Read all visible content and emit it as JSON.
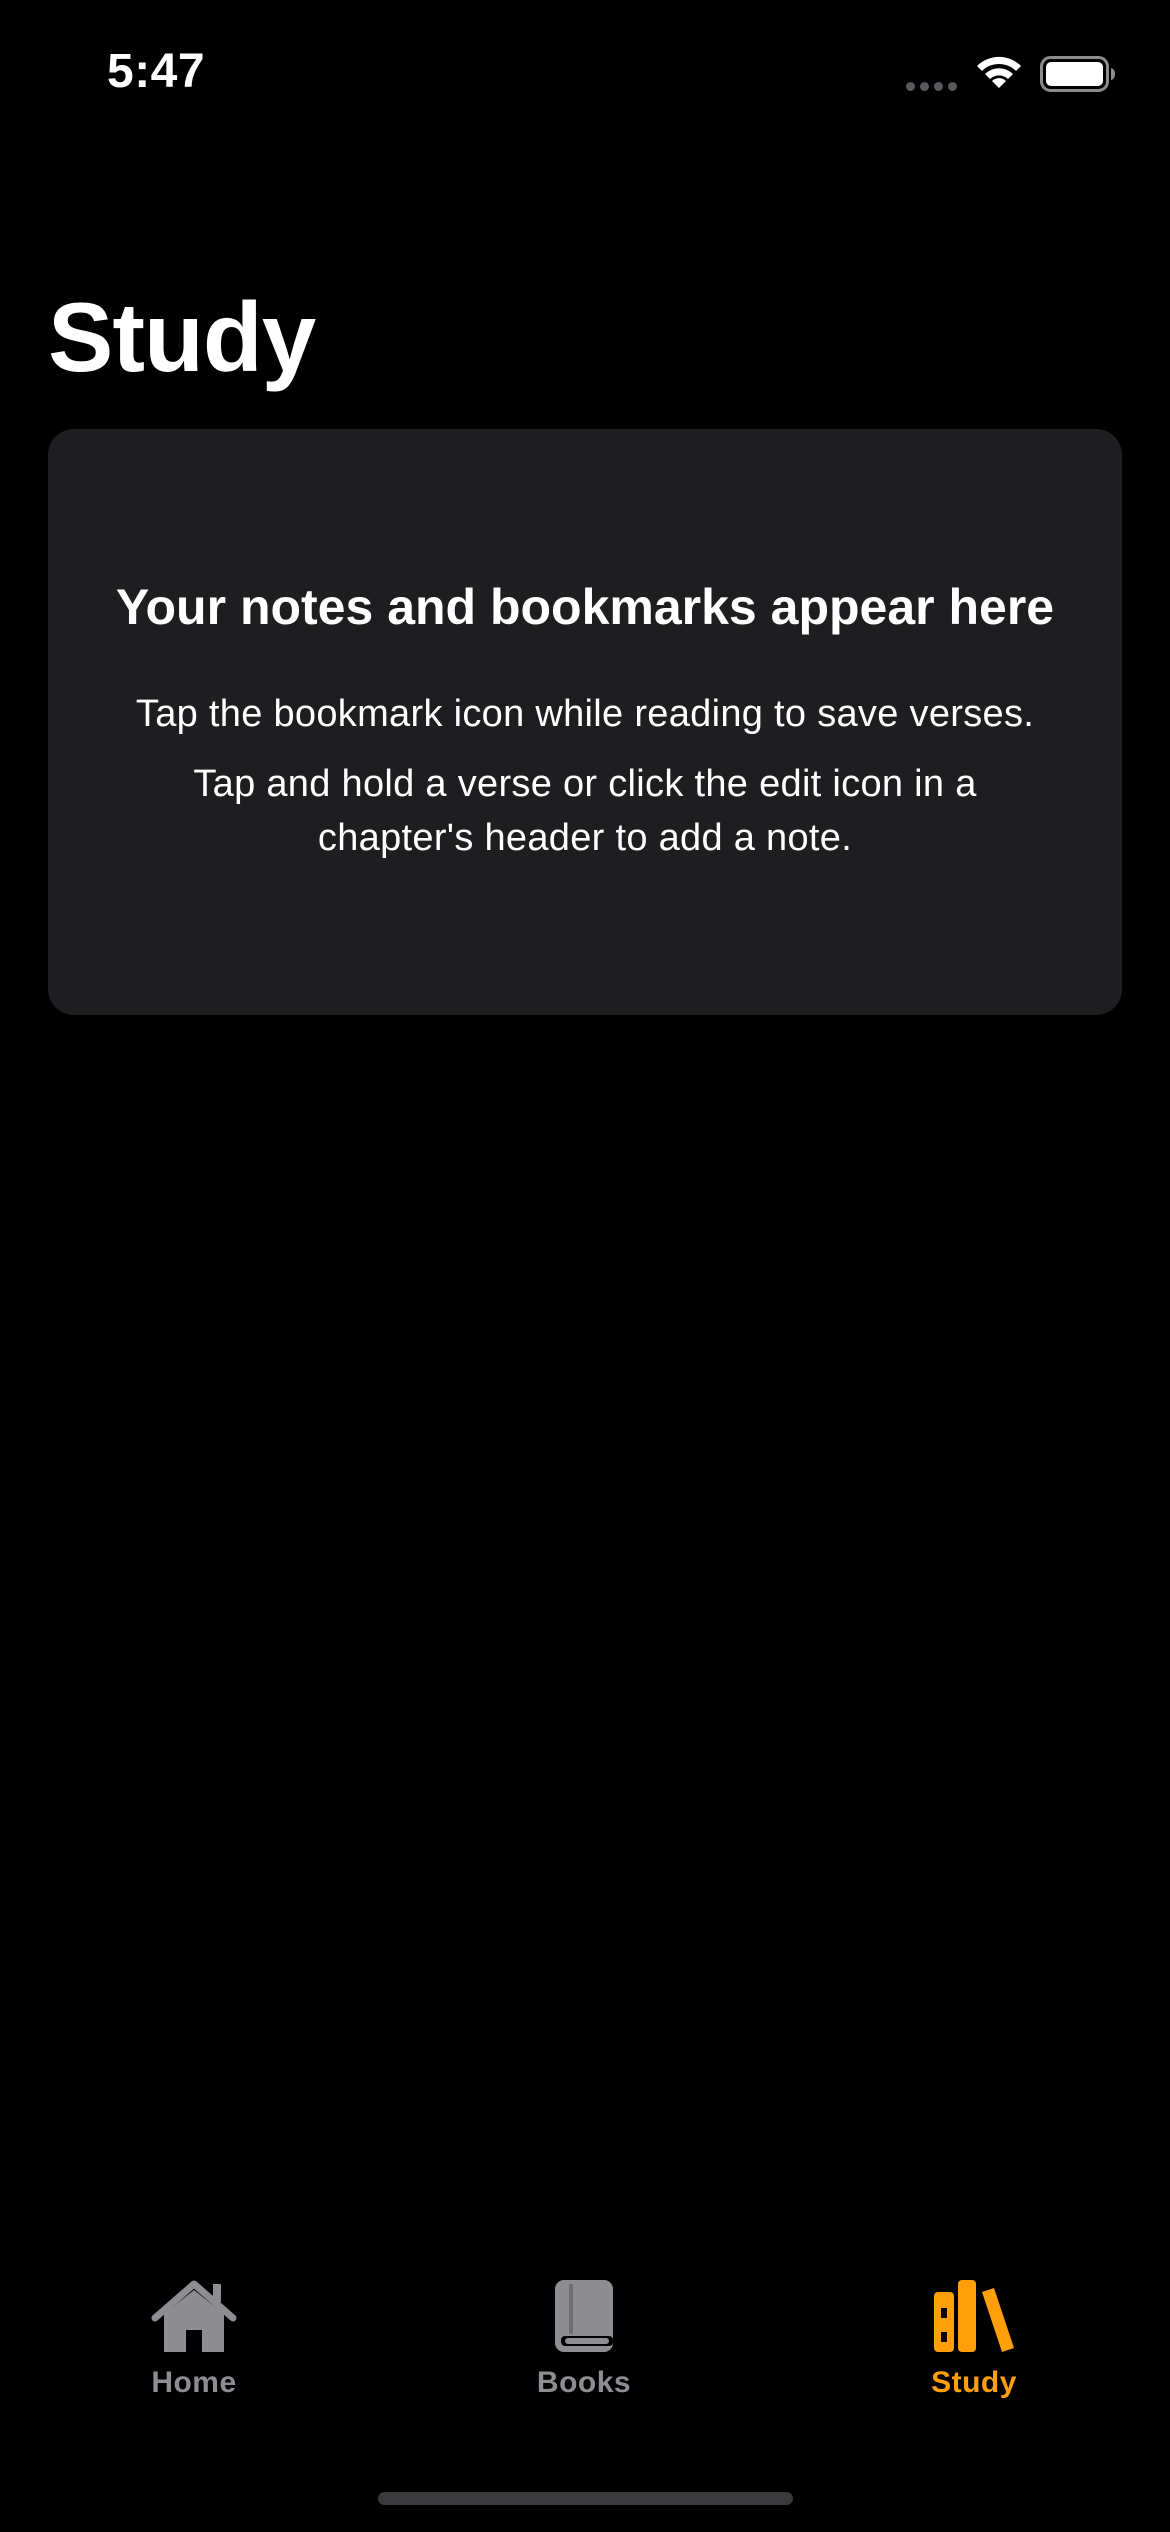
{
  "status_bar": {
    "time": "5:47",
    "wifi_icon": "wifi-icon",
    "battery_icon": "battery-icon"
  },
  "page": {
    "title": "Study"
  },
  "empty_state": {
    "heading": "Your notes and bookmarks appear here",
    "line1": "Tap the bookmark icon while reading to save verses.",
    "line2": "Tap and hold a verse or click the edit icon in a chapter's header to add a note."
  },
  "tab_bar": {
    "tabs": [
      {
        "label": "Home",
        "icon": "house-icon",
        "active": false
      },
      {
        "label": "Books",
        "icon": "book-icon",
        "active": false
      },
      {
        "label": "Study",
        "icon": "books-shelf-icon",
        "active": true
      }
    ]
  },
  "colors": {
    "background": "#000000",
    "card": "#1e1e20",
    "accent": "#ff9f0a",
    "inactive": "#8d8d92"
  }
}
